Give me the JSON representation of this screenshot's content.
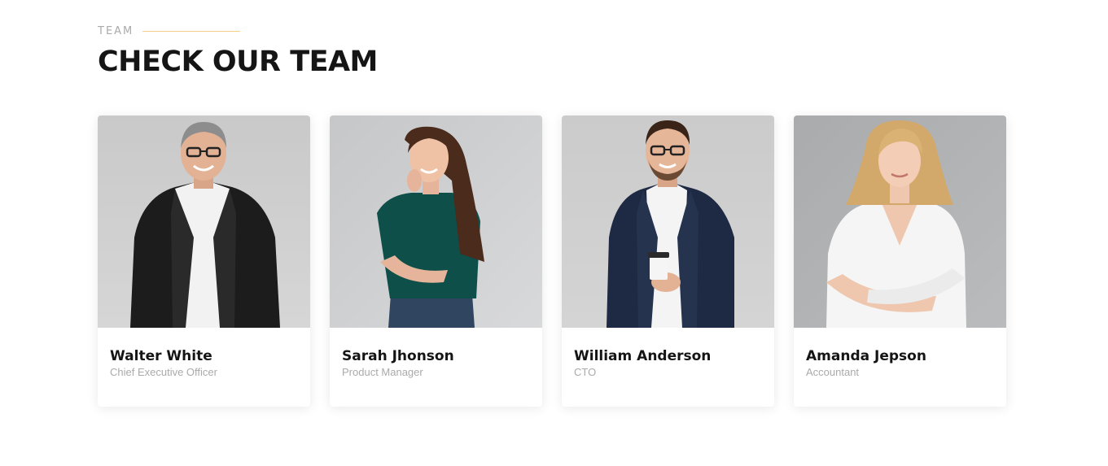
{
  "section": {
    "eyebrow": "TEAM",
    "title": "CHECK OUR TEAM",
    "accent_color": "#f3cf8b"
  },
  "team": [
    {
      "name": "Walter White",
      "role": "Chief Executive Officer",
      "photo_icon": "portrait-man-black-blazer-glasses"
    },
    {
      "name": "Sarah Jhonson",
      "role": "Product Manager",
      "photo_icon": "portrait-woman-green-top"
    },
    {
      "name": "William Anderson",
      "role": "CTO",
      "photo_icon": "portrait-man-navy-suit-coffee"
    },
    {
      "name": "Amanda Jepson",
      "role": "Accountant",
      "photo_icon": "portrait-woman-white-blouse"
    }
  ]
}
